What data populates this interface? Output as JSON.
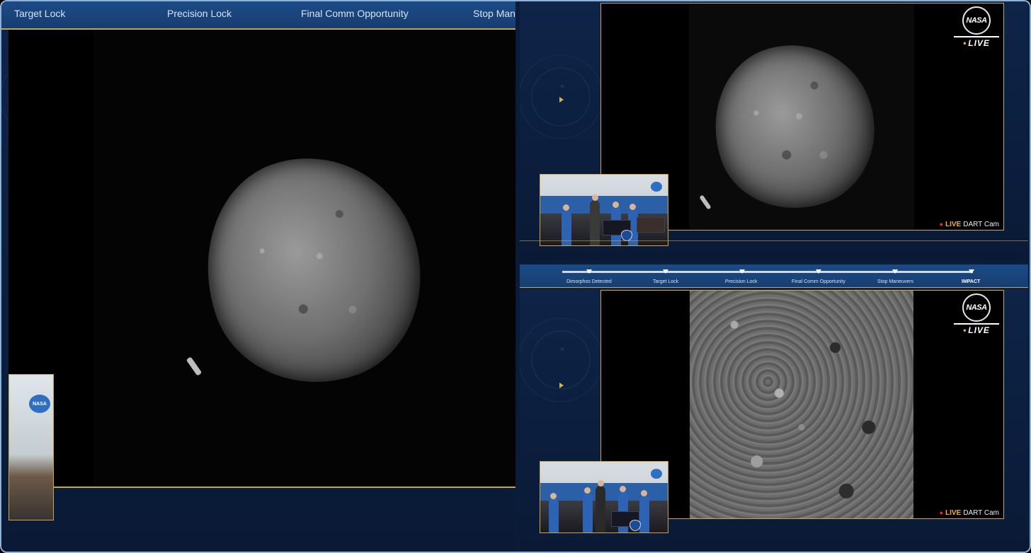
{
  "left_panel": {
    "steps": [
      "Target Lock",
      "Precision Lock",
      "Final Comm Opportunity",
      "Stop Man"
    ],
    "mini_room_logo": "NASA"
  },
  "right_top": {
    "badge": {
      "logo": "NASA",
      "live": "LIVE"
    },
    "cam_label": {
      "live": "LIVE",
      "name": "DART Cam"
    },
    "room_logo": "NASA"
  },
  "right_bottom": {
    "progress_steps": [
      "Dimorphos Detected",
      "Target Lock",
      "Precision Lock",
      "Final Comm Opportunity",
      "Stop Maneuvers",
      "IMPACT"
    ],
    "badge": {
      "logo": "NASA",
      "live": "LIVE"
    },
    "cam_label": {
      "live": "LIVE",
      "name": "DART Cam"
    }
  },
  "colors": {
    "accent_gold": "#c9a64a",
    "panel_blue": "#0e2448",
    "bar_blue": "#1b4a85",
    "live_red": "#ff2a2a",
    "live_yellow": "#f2b134"
  }
}
